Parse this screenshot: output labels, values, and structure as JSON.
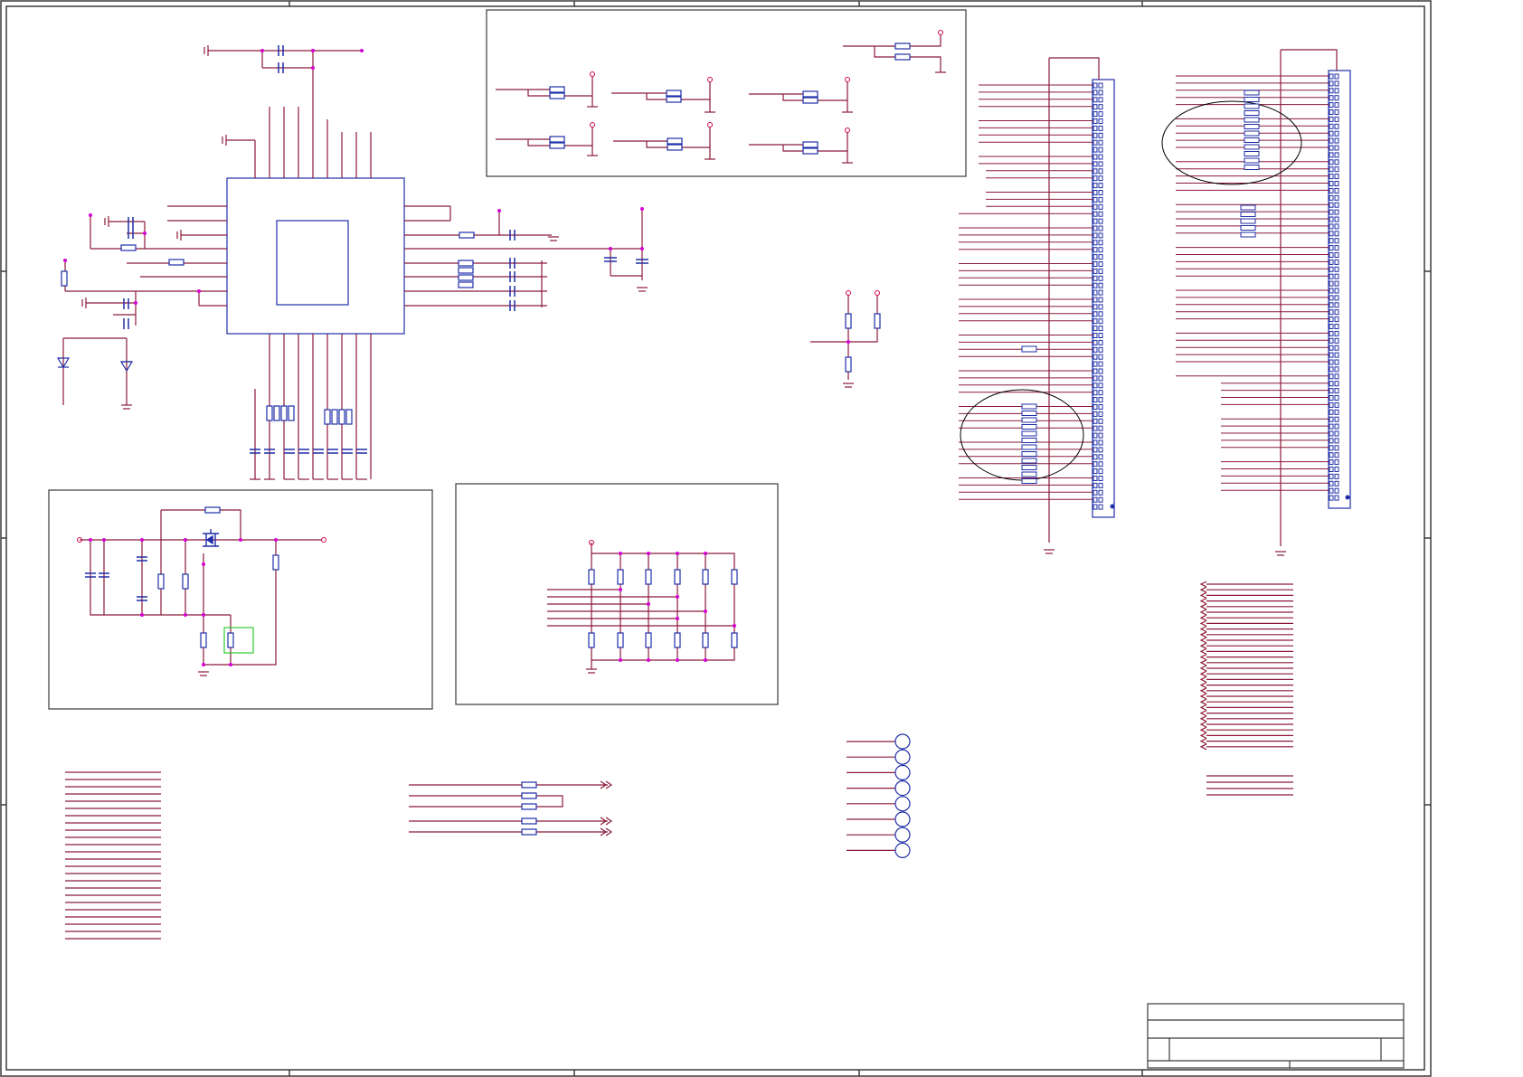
{
  "sheet": {
    "title_block_text": [],
    "colors": {
      "frame": "#3a3a3a",
      "wire": "#8b1a3a",
      "component": "#1f2ea8",
      "junction": "#d400d4",
      "highlight": "#2ecc2e",
      "circle_mark": "#000000"
    }
  },
  "icons": [
    "resistor-icon",
    "capacitor-icon",
    "ground-icon",
    "diode-icon",
    "mosfet-icon",
    "test-point-icon",
    "connector-icon",
    "net-arrow-icon",
    "no-connect-icon"
  ]
}
